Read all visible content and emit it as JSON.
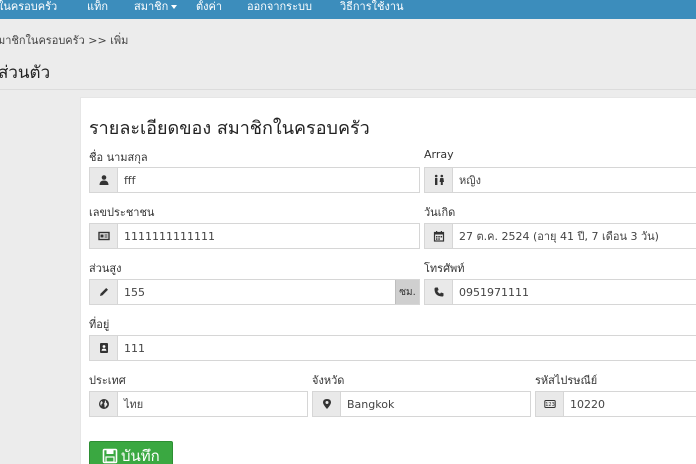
{
  "nav": {
    "family_members": "ในครอบครัว",
    "tags": "แท็ก",
    "members": "สมาชิก",
    "settings": "ตั้งค่า",
    "logout": "ออกจากระบบ",
    "howto": "วิธีการใช้งาน"
  },
  "breadcrumb": "มาชิกในครอบครัว >> เพิ่ม",
  "page_title": "ส่วนตัว",
  "panel_title": "รายละเอียดของ สมาชิกในครอบครัว",
  "fields": {
    "name": {
      "label": "ชื่อ นามสกุล",
      "value": "fff",
      "icon": "user-icon"
    },
    "gender": {
      "label": "Array",
      "value": "หญิง",
      "icon": "gender-icon"
    },
    "id_card": {
      "label": "เลขประชาชน",
      "value": "1111111111111",
      "icon": "id-card-icon"
    },
    "birthday": {
      "label": "วันเกิด",
      "value": "27 ต.ค. 2524 (อายุ 41 ปี, 7 เดือน 3 วัน)",
      "icon": "calendar-icon"
    },
    "height": {
      "label": "ส่วนสูง",
      "value": "155",
      "unit": "ซม.",
      "icon": "pencil-icon"
    },
    "phone": {
      "label": "โทรศัพท์",
      "value": "0951971111",
      "icon": "phone-icon"
    },
    "address": {
      "label": "ที่อยู่",
      "value": "111",
      "icon": "address-card-icon"
    },
    "country": {
      "label": "ประเทศ",
      "value": "ไทย",
      "icon": "globe-icon"
    },
    "province": {
      "label": "จังหวัด",
      "value": "Bangkok",
      "icon": "map-pin-icon"
    },
    "postcode": {
      "label": "รหัสไปรษณีย์",
      "value": "10220",
      "icon": "number-icon"
    }
  },
  "save_button": "บันทึก",
  "colors": {
    "navbar": "#3c8dbc",
    "save": "#3aa841"
  }
}
